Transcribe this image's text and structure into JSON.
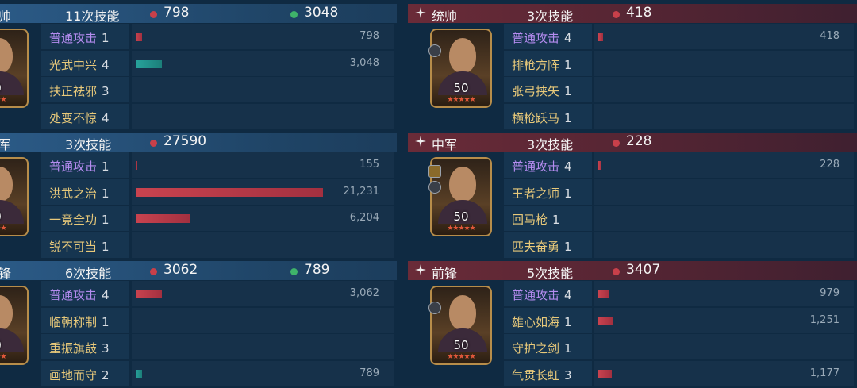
{
  "left": [
    {
      "role": "帅",
      "count": "11次技能",
      "damage": "798",
      "heal": "3048",
      "level": "0",
      "stars": "★★★",
      "skills": [
        {
          "name": "普通攻击",
          "level": "1",
          "basic": true,
          "value": "798",
          "bar": 0.035,
          "color": "red"
        },
        {
          "name": "光武中兴",
          "level": "4",
          "basic": false,
          "value": "3,048",
          "bar": 0.14,
          "color": "teal"
        },
        {
          "name": "扶正祛邪",
          "level": "3",
          "basic": false,
          "value": "",
          "bar": 0,
          "color": "red"
        },
        {
          "name": "处变不惊",
          "level": "4",
          "basic": false,
          "value": "",
          "bar": 0,
          "color": "red"
        }
      ]
    },
    {
      "role": "军",
      "count": "3次技能",
      "damage": "27590",
      "heal": "",
      "level": "0",
      "stars": "★★★",
      "skills": [
        {
          "name": "普通攻击",
          "level": "1",
          "basic": true,
          "value": "155",
          "bar": 0.007,
          "color": "red"
        },
        {
          "name": "洪武之治",
          "level": "1",
          "basic": false,
          "value": "21,231",
          "bar": 1.0,
          "color": "red"
        },
        {
          "name": "一竟全功",
          "level": "1",
          "basic": false,
          "value": "6,204",
          "bar": 0.29,
          "color": "red"
        },
        {
          "name": "锐不可当",
          "level": "1",
          "basic": false,
          "value": "",
          "bar": 0,
          "color": "red"
        }
      ]
    },
    {
      "role": "锋",
      "count": "6次技能",
      "damage": "3062",
      "heal": "789",
      "level": "0",
      "stars": "★★★",
      "skills": [
        {
          "name": "普通攻击",
          "level": "4",
          "basic": true,
          "value": "3,062",
          "bar": 0.14,
          "color": "red"
        },
        {
          "name": "临朝称制",
          "level": "1",
          "basic": false,
          "value": "",
          "bar": 0,
          "color": "red"
        },
        {
          "name": "重振旗鼓",
          "level": "3",
          "basic": false,
          "value": "",
          "bar": 0,
          "color": "red"
        },
        {
          "name": "画地而守",
          "level": "2",
          "basic": false,
          "value": "789",
          "bar": 0.035,
          "color": "teal"
        }
      ]
    }
  ],
  "right": [
    {
      "role": "统帅",
      "count": "3次技能",
      "damage": "418",
      "level": "50",
      "stars": "★★★★★",
      "skills": [
        {
          "name": "普通攻击",
          "level": "4",
          "basic": true,
          "value": "418",
          "bar": 0.02,
          "color": "red"
        },
        {
          "name": "排枪方阵",
          "level": "1",
          "basic": false,
          "value": "",
          "bar": 0,
          "color": "red"
        },
        {
          "name": "张弓挟矢",
          "level": "1",
          "basic": false,
          "value": "",
          "bar": 0,
          "color": "red"
        },
        {
          "name": "横枪跃马",
          "level": "1",
          "basic": false,
          "value": "",
          "bar": 0,
          "color": "red"
        }
      ]
    },
    {
      "role": "中军",
      "count": "3次技能",
      "damage": "228",
      "level": "50",
      "stars": "★★★★★",
      "skills": [
        {
          "name": "普通攻击",
          "level": "4",
          "basic": true,
          "value": "228",
          "bar": 0.012,
          "color": "red"
        },
        {
          "name": "王者之师",
          "level": "1",
          "basic": false,
          "value": "",
          "bar": 0,
          "color": "red"
        },
        {
          "name": "回马枪",
          "level": "1",
          "basic": false,
          "value": "",
          "bar": 0,
          "color": "red"
        },
        {
          "name": "匹夫奋勇",
          "level": "1",
          "basic": false,
          "value": "",
          "bar": 0,
          "color": "red"
        }
      ]
    },
    {
      "role": "前锋",
      "count": "5次技能",
      "damage": "3407",
      "level": "50",
      "stars": "★★★★★",
      "skills": [
        {
          "name": "普通攻击",
          "level": "4",
          "basic": true,
          "value": "979",
          "bar": 0.045,
          "color": "red"
        },
        {
          "name": "雄心如海",
          "level": "1",
          "basic": false,
          "value": "1,251",
          "bar": 0.058,
          "color": "red"
        },
        {
          "name": "守护之剑",
          "level": "1",
          "basic": false,
          "value": "",
          "bar": 0,
          "color": "red"
        },
        {
          "name": "气贯长虹",
          "level": "3",
          "basic": false,
          "value": "1,177",
          "bar": 0.055,
          "color": "red"
        }
      ]
    }
  ]
}
